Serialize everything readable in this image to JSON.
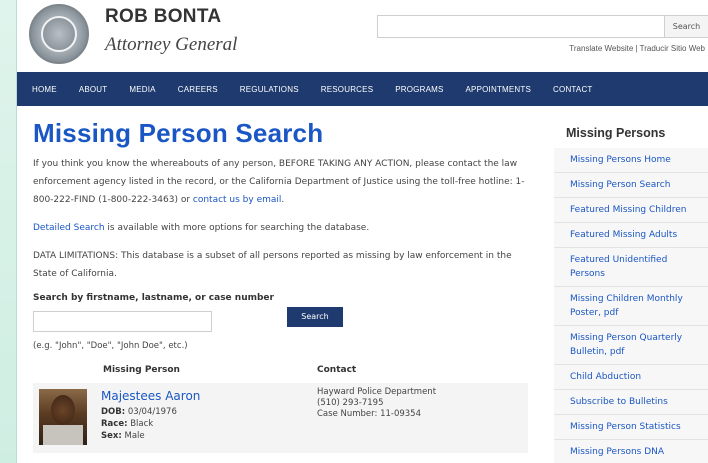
{
  "header": {
    "name": "ROB BONTA",
    "subtitle": "Attorney General",
    "search_button": "Search",
    "translate": "Translate Website | Traducir Sitio Web"
  },
  "nav": [
    "HOME",
    "ABOUT",
    "MEDIA",
    "CAREERS",
    "REGULATIONS",
    "RESOURCES",
    "PROGRAMS",
    "APPOINTMENTS",
    "CONTACT"
  ],
  "main": {
    "title": "Missing Person Search",
    "intro_before_link": "If you think you know the whereabouts of any person, BEFORE TAKING ANY ACTION, please contact the law enforcement agency listed in the record, or the California Department of Justice using the toll-free hotline: 1-800-222-FIND (1-800-222-3463) or ",
    "intro_link": "contact us by email",
    "intro_after_link": ".",
    "detailed_link": "Detailed Search",
    "detailed_text": " is available with more options for searching the database.",
    "limitations": "DATA LIMITATIONS: This database is a subset of all persons reported as missing by law enforcement in the State of California.",
    "search_label": "Search by firstname, lastname, or case number",
    "search_value": "",
    "search_button": "Search",
    "hint": "(e.g. \"John\", \"Doe\", \"John Doe\", etc.)",
    "columns": {
      "person": "Missing Person",
      "contact": "Contact"
    },
    "row": {
      "name": "Majestees Aaron",
      "dob_label": "DOB:",
      "dob": "03/04/1976",
      "race_label": "Race:",
      "race": "Black",
      "sex_label": "Sex:",
      "sex": "Male",
      "agency": "Hayward Police Department",
      "phone": "(510) 293-7195",
      "case": "Case Number: 11-09354"
    }
  },
  "sidebar": {
    "title": "Missing Persons",
    "items": [
      "Missing Persons Home",
      "Missing Person Search",
      "Featured Missing Children",
      "Featured Missing Adults",
      "Featured Unidentified Persons",
      "Missing Children Monthly Poster, pdf",
      "Missing Person Quarterly Bulletin, pdf",
      "Child Abduction",
      "Subscribe to Bulletins",
      "Missing Person Statistics",
      "Missing Persons DNA"
    ]
  },
  "colors": {
    "nav": "#1f3a6e",
    "link": "#1a56c4"
  },
  "icons": {
    "seal": "state-seal-icon"
  }
}
